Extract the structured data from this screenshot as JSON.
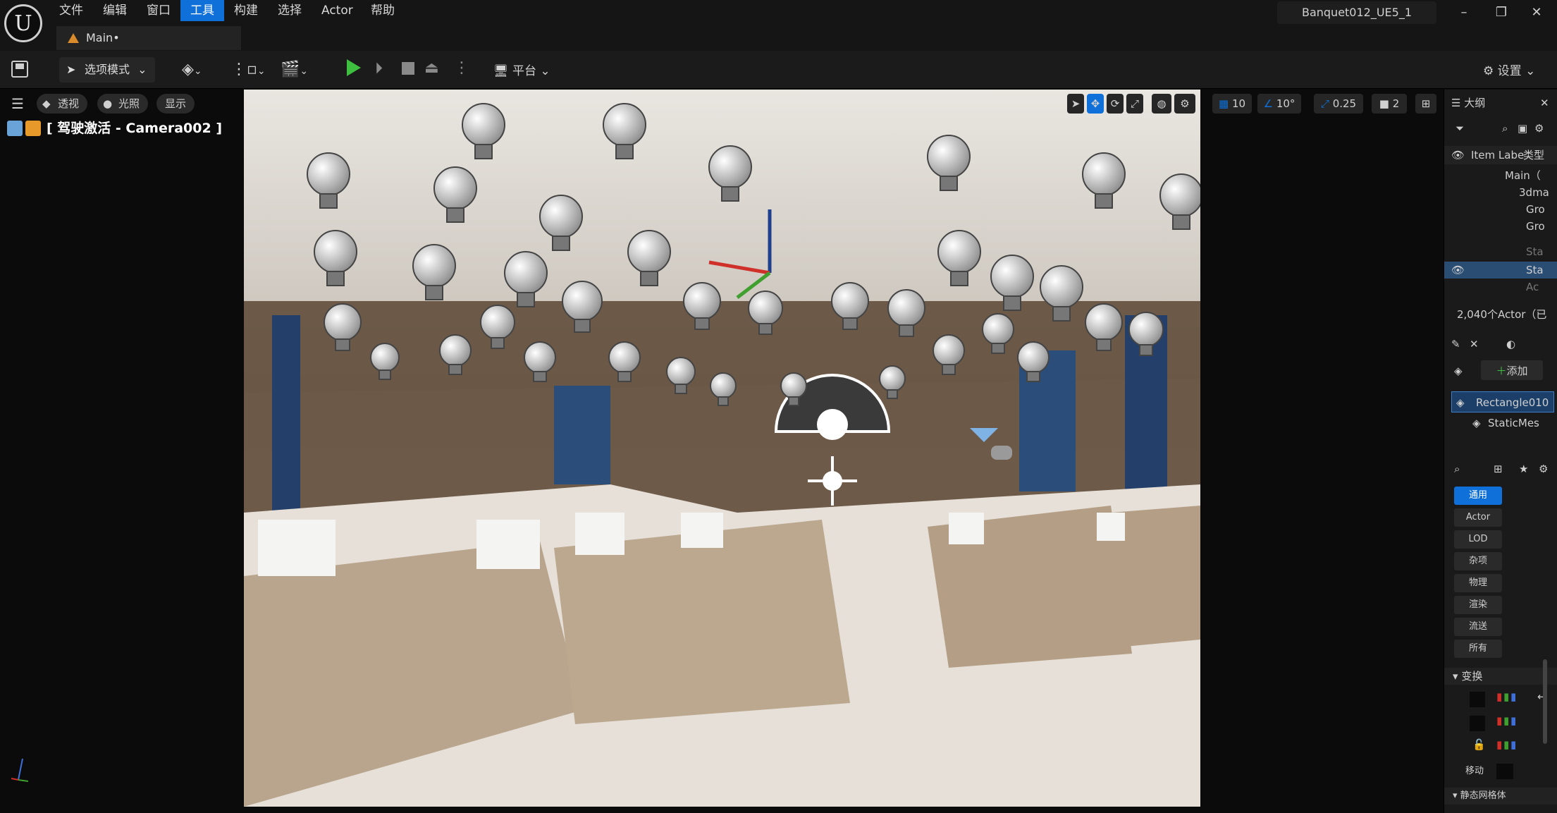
{
  "menu": [
    "文件",
    "编辑",
    "窗口",
    "工具",
    "构建",
    "选择",
    "Actor",
    "帮助"
  ],
  "active_menu": "工具",
  "tab": {
    "label": "Main•"
  },
  "project_name": "Banquet012_UE5_1",
  "window_controls": {
    "minimize": "–",
    "restore": "❐",
    "close": "✕"
  },
  "toolbar": {
    "mode_label": "选项模式",
    "platform_label": "平台",
    "settings_label": "设置"
  },
  "viewport_bar": {
    "perspective": "透视",
    "lighting": "光照",
    "show": "显示",
    "camera_label": "[ 驾驶激活 - Camera002 ]",
    "grid_snap": "10",
    "rotation_snap": "10°",
    "scale_snap": "0.25",
    "camera_speed": "2"
  },
  "outliner": {
    "title": "大纲",
    "col_label": "Item Labe",
    "col_type": "类型",
    "rows": [
      "Main（",
      "3dma",
      "Gro",
      "Gro",
      "Sta",
      "Sta",
      "Ac"
    ],
    "actor_count": "2,040个Actor（已"
  },
  "details": {
    "add_label": "添加",
    "component_root": "Rectangle010",
    "component_child": "StaticMes",
    "categories": [
      "通用",
      "Actor",
      "LOD",
      "杂项",
      "物理",
      "渲染",
      "流送",
      "所有"
    ],
    "selected_category": "通用",
    "transform_label": "变换",
    "mobility_label": "移动",
    "static_mesh_label": "静态网格体"
  },
  "colors": {
    "accent": "#0e70d8",
    "play": "#3fbf3f",
    "bg": "#151515"
  }
}
